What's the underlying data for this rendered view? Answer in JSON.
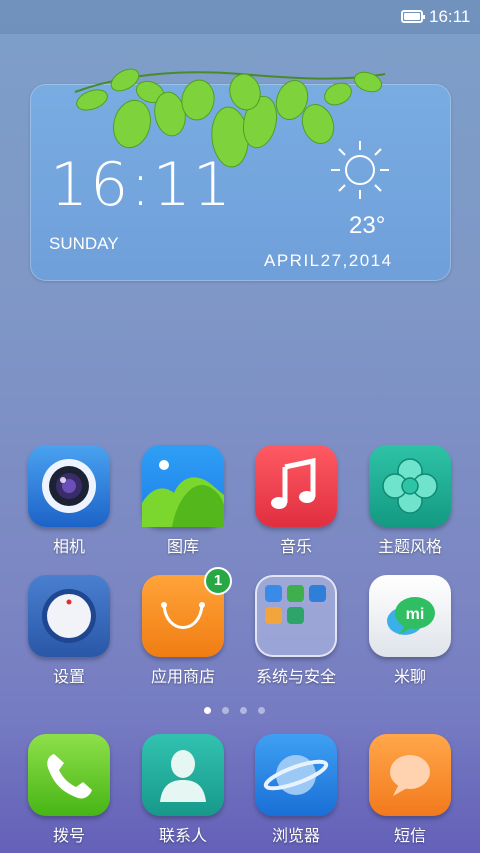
{
  "status_bar": {
    "time": "16:11",
    "battery_icon": "battery-full-icon"
  },
  "widget": {
    "time": "16:11",
    "day": "SUNDAY",
    "temperature": "23°",
    "date": "APRIL27,2014",
    "weather_icon": "sun-icon",
    "decoration": "leaves"
  },
  "apps_row1": [
    {
      "label": "相机",
      "icon": "camera-icon"
    },
    {
      "label": "图库",
      "icon": "gallery-icon"
    },
    {
      "label": "音乐",
      "icon": "music-icon"
    },
    {
      "label": "主题风格",
      "icon": "theme-icon"
    }
  ],
  "apps_row2": [
    {
      "label": "设置",
      "icon": "settings-icon"
    },
    {
      "label": "应用商店",
      "icon": "app-store-icon",
      "badge": "1"
    },
    {
      "label": "系统与安全",
      "icon": "folder-icon"
    },
    {
      "label": "米聊",
      "icon": "miliao-icon",
      "icon_text": "mi"
    }
  ],
  "page_indicator": {
    "count": 4,
    "active": 1
  },
  "dock": [
    {
      "label": "拨号",
      "icon": "phone-icon"
    },
    {
      "label": "联系人",
      "icon": "contacts-icon"
    },
    {
      "label": "浏览器",
      "icon": "browser-icon"
    },
    {
      "label": "短信",
      "icon": "messages-icon"
    }
  ]
}
